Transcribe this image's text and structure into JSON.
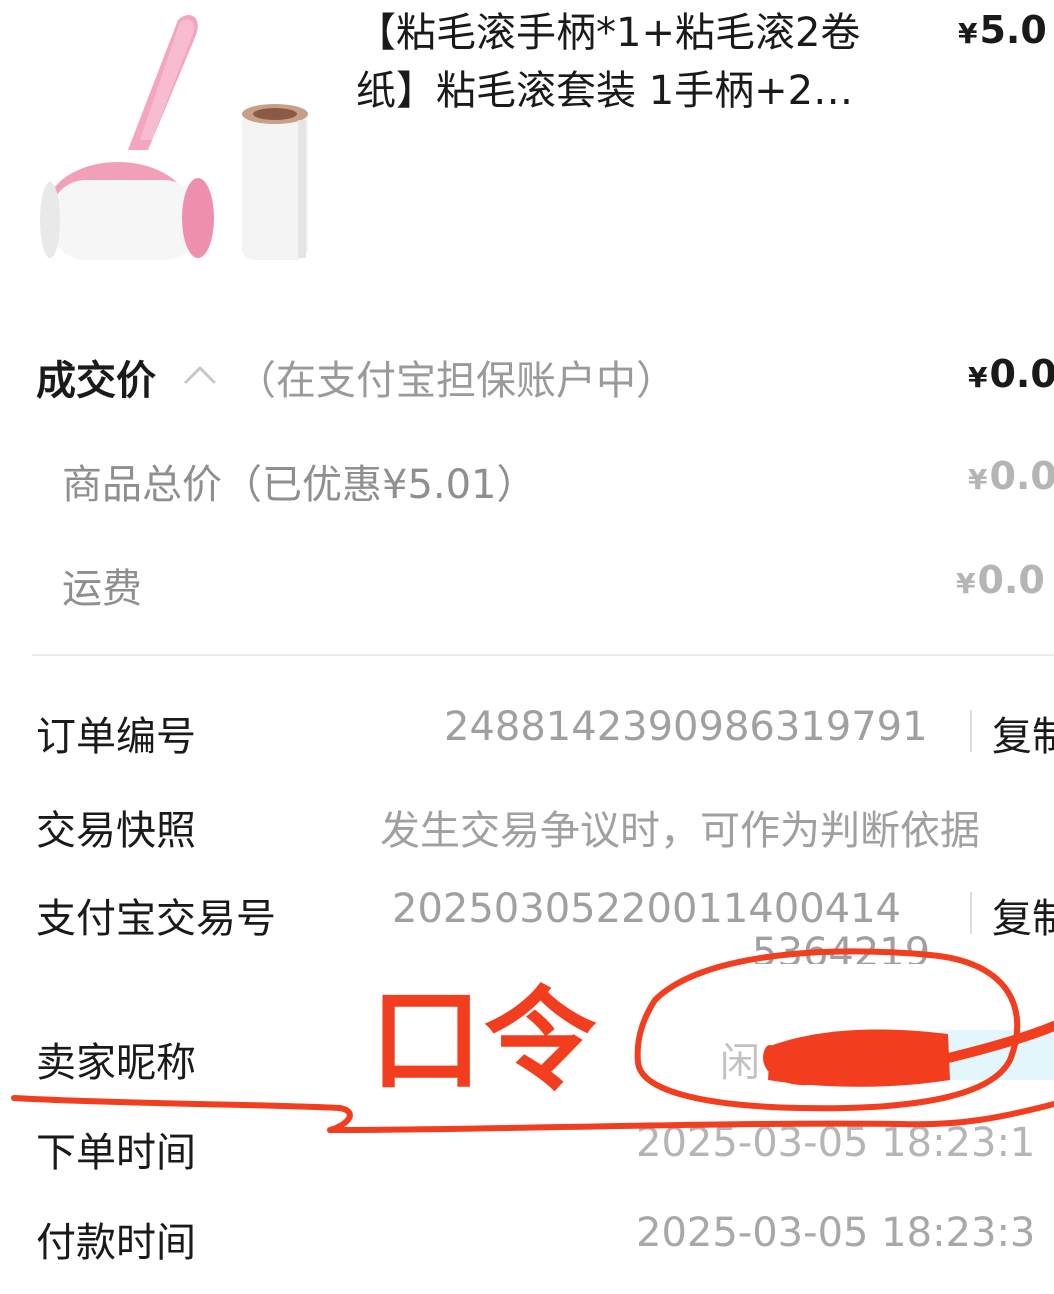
{
  "product": {
    "title": "【粘毛滚手柄*1+粘毛滚2卷纸】粘毛滚套装 1手柄+2…",
    "price_symbol": "¥",
    "price": "5.0",
    "image_icon": "lint-roller-product-image"
  },
  "pricing": {
    "deal_label": "成交价",
    "deal_toggle_icon": "chevron-up-icon",
    "escrow_note": "（在支付宝担保账户中）",
    "deal_price": "0.0",
    "goods_total_label": "商品总价（已优惠¥5.01）",
    "goods_total_price": "0.0",
    "shipping_label": "运费",
    "shipping_price": "0.0",
    "currency_symbol": "¥"
  },
  "order_info": {
    "order_no_label": "订单编号",
    "order_no_value": "2488142390986319791",
    "copy_label": "复制",
    "snapshot_label": "交易快照",
    "snapshot_value": "发生交易争议时，可作为判断依据",
    "alipay_no_label": "支付宝交易号",
    "alipay_no_value": "20250305220011400414",
    "alipay_no_value_line2": "5364219",
    "seller_label": "卖家昵称",
    "seller_value": "闲",
    "order_time_label": "下单时间",
    "order_time_value": "2025-03-05 18:23:1",
    "pay_time_label": "付款时间",
    "pay_time_value": "2025-03-05 18:23:3"
  },
  "annotation": {
    "text": "口令",
    "color": "#f23d1f"
  }
}
